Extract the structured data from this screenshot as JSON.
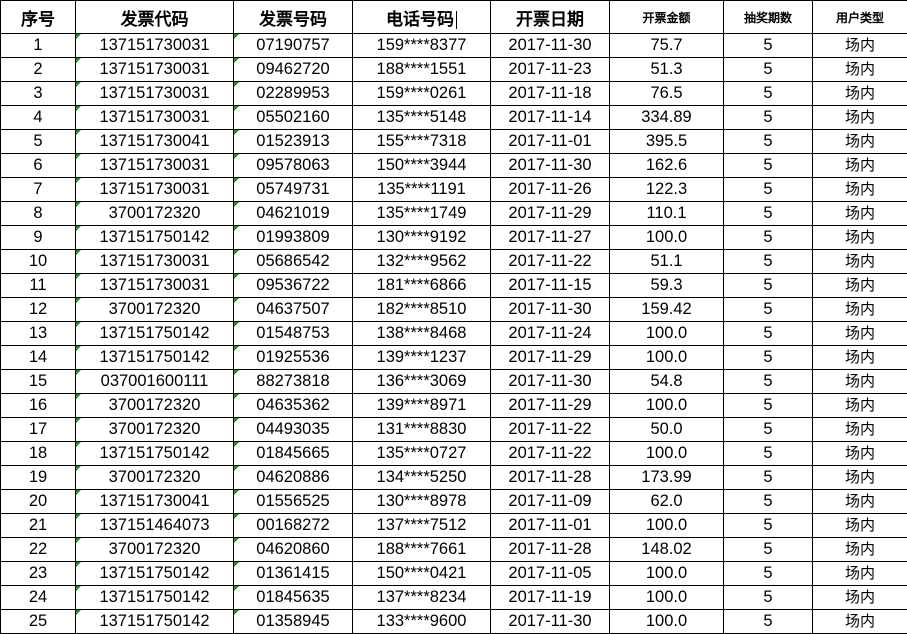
{
  "headers": [
    "序号",
    "发票代码",
    "发票号码",
    "电话号码",
    "开票日期",
    "开票金额",
    "抽奖期数",
    "用户类型"
  ],
  "rows": [
    [
      "1",
      "137151730031",
      "07190757",
      "159****8377",
      "2017-11-30",
      "75.7",
      "5",
      "场内"
    ],
    [
      "2",
      "137151730031",
      "09462720",
      "188****1551",
      "2017-11-23",
      "51.3",
      "5",
      "场内"
    ],
    [
      "3",
      "137151730031",
      "02289953",
      "159****0261",
      "2017-11-18",
      "76.5",
      "5",
      "场内"
    ],
    [
      "4",
      "137151730031",
      "05502160",
      "135****5148",
      "2017-11-14",
      "334.89",
      "5",
      "场内"
    ],
    [
      "5",
      "137151730041",
      "01523913",
      "155****7318",
      "2017-11-01",
      "395.5",
      "5",
      "场内"
    ],
    [
      "6",
      "137151730031",
      "09578063",
      "150****3944",
      "2017-11-30",
      "162.6",
      "5",
      "场内"
    ],
    [
      "7",
      "137151730031",
      "05749731",
      "135****1191",
      "2017-11-26",
      "122.3",
      "5",
      "场内"
    ],
    [
      "8",
      "3700172320",
      "04621019",
      "135****1749",
      "2017-11-29",
      "110.1",
      "5",
      "场内"
    ],
    [
      "9",
      "137151750142",
      "01993809",
      "130****9192",
      "2017-11-27",
      "100.0",
      "5",
      "场内"
    ],
    [
      "10",
      "137151730031",
      "05686542",
      "132****9562",
      "2017-11-22",
      "51.1",
      "5",
      "场内"
    ],
    [
      "11",
      "137151730031",
      "09536722",
      "181****6866",
      "2017-11-15",
      "59.3",
      "5",
      "场内"
    ],
    [
      "12",
      "3700172320",
      "04637507",
      "182****8510",
      "2017-11-30",
      "159.42",
      "5",
      "场内"
    ],
    [
      "13",
      "137151750142",
      "01548753",
      "138****8468",
      "2017-11-24",
      "100.0",
      "5",
      "场内"
    ],
    [
      "14",
      "137151750142",
      "01925536",
      "139****1237",
      "2017-11-29",
      "100.0",
      "5",
      "场内"
    ],
    [
      "15",
      "037001600111",
      "88273818",
      "136****3069",
      "2017-11-30",
      "54.8",
      "5",
      "场内"
    ],
    [
      "16",
      "3700172320",
      "04635362",
      "139****8971",
      "2017-11-29",
      "100.0",
      "5",
      "场内"
    ],
    [
      "17",
      "3700172320",
      "04493035",
      "131****8830",
      "2017-11-22",
      "50.0",
      "5",
      "场内"
    ],
    [
      "18",
      "137151750142",
      "01845665",
      "135****0727",
      "2017-11-22",
      "100.0",
      "5",
      "场内"
    ],
    [
      "19",
      "3700172320",
      "04620886",
      "134****5250",
      "2017-11-28",
      "173.99",
      "5",
      "场内"
    ],
    [
      "20",
      "137151730041",
      "01556525",
      "130****8978",
      "2017-11-09",
      "62.0",
      "5",
      "场内"
    ],
    [
      "21",
      "137151464073",
      "00168272",
      "137****7512",
      "2017-11-01",
      "100.0",
      "5",
      "场内"
    ],
    [
      "22",
      "3700172320",
      "04620860",
      "188****7661",
      "2017-11-28",
      "148.02",
      "5",
      "场内"
    ],
    [
      "23",
      "137151750142",
      "01361415",
      "150****0421",
      "2017-11-05",
      "100.0",
      "5",
      "场内"
    ],
    [
      "24",
      "137151750142",
      "01845635",
      "137****8234",
      "2017-11-19",
      "100.0",
      "5",
      "场内"
    ],
    [
      "25",
      "137151750142",
      "01358945",
      "133****9600",
      "2017-11-30",
      "100.0",
      "5",
      "场内"
    ]
  ]
}
